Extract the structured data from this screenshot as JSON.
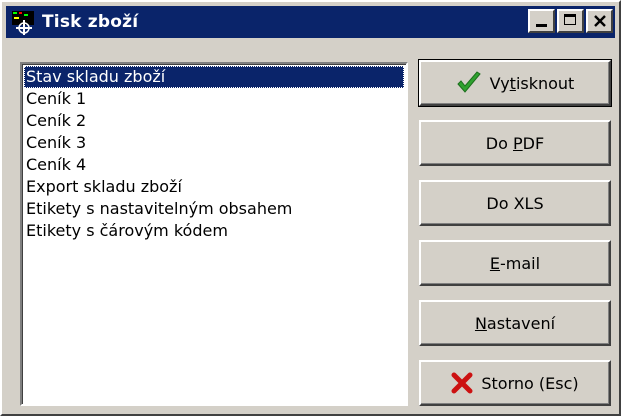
{
  "window": {
    "title": "Tisk zboží",
    "icon": "printer-app-icon"
  },
  "list": {
    "items": [
      "Stav skladu zboží",
      "Ceník 1",
      "Ceník 2",
      "Ceník 3",
      "Ceník 4",
      "Export skladu zboží",
      "Etikety s nastavitelným obsahem",
      "Etikety s čárovým kódem"
    ],
    "selected_index": 0
  },
  "buttons": {
    "print": {
      "pre": "Vy",
      "accel": "t",
      "post": "isknout",
      "icon": "checkmark-icon"
    },
    "pdf": {
      "pre": "Do ",
      "accel": "P",
      "post": "DF"
    },
    "xls": {
      "label": "Do XLS"
    },
    "email": {
      "pre": "",
      "accel": "E",
      "post": "-mail"
    },
    "settings": {
      "pre": "",
      "accel": "N",
      "post": "astavení"
    },
    "cancel": {
      "label": "Storno (Esc)",
      "icon": "red-x-icon"
    }
  },
  "colors": {
    "title_bar": "#0a246a",
    "selection": "#0a246a",
    "face": "#d4d0c8",
    "check": "#2fa12f",
    "cancel_x": "#cc1111"
  }
}
